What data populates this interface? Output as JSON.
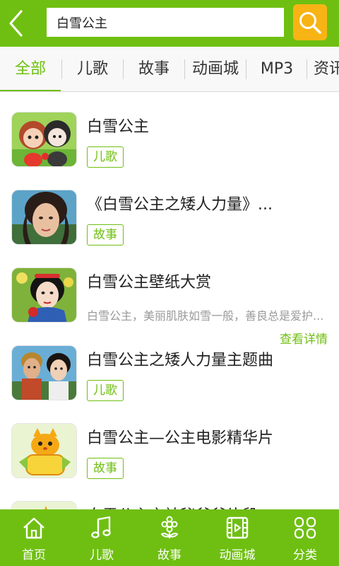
{
  "header": {
    "search_value": "白雪公主"
  },
  "tabs": [
    {
      "label": "全部",
      "active": true
    },
    {
      "label": "儿歌"
    },
    {
      "label": "故事"
    },
    {
      "label": "动画城"
    },
    {
      "label": "MP3"
    },
    {
      "label": "资讯"
    }
  ],
  "items": [
    {
      "title": "白雪公主",
      "tag": "儿歌"
    },
    {
      "title": "《白雪公主之矮人力量》...",
      "tag": "故事"
    },
    {
      "title": "白雪公主壁纸大赏",
      "description": "白雪公主，美丽肌肤如雪一般，善良总是爱护...",
      "more": "查看详情"
    },
    {
      "title": "白雪公主之矮人力量主题曲",
      "tag": "儿歌"
    },
    {
      "title": "白雪公主—公主电影精华片",
      "tag": "故事"
    },
    {
      "title": "白雪公主之神秘爷爷片段"
    }
  ],
  "bottom_nav": [
    {
      "label": "首页",
      "icon": "home-icon"
    },
    {
      "label": "儿歌",
      "icon": "music-note-icon"
    },
    {
      "label": "故事",
      "icon": "flower-icon"
    },
    {
      "label": "动画城",
      "icon": "film-icon"
    },
    {
      "label": "分类",
      "icon": "grid-icon"
    }
  ],
  "colors": {
    "primary_green": "#6fbf12",
    "search_orange": "#f8b414"
  }
}
